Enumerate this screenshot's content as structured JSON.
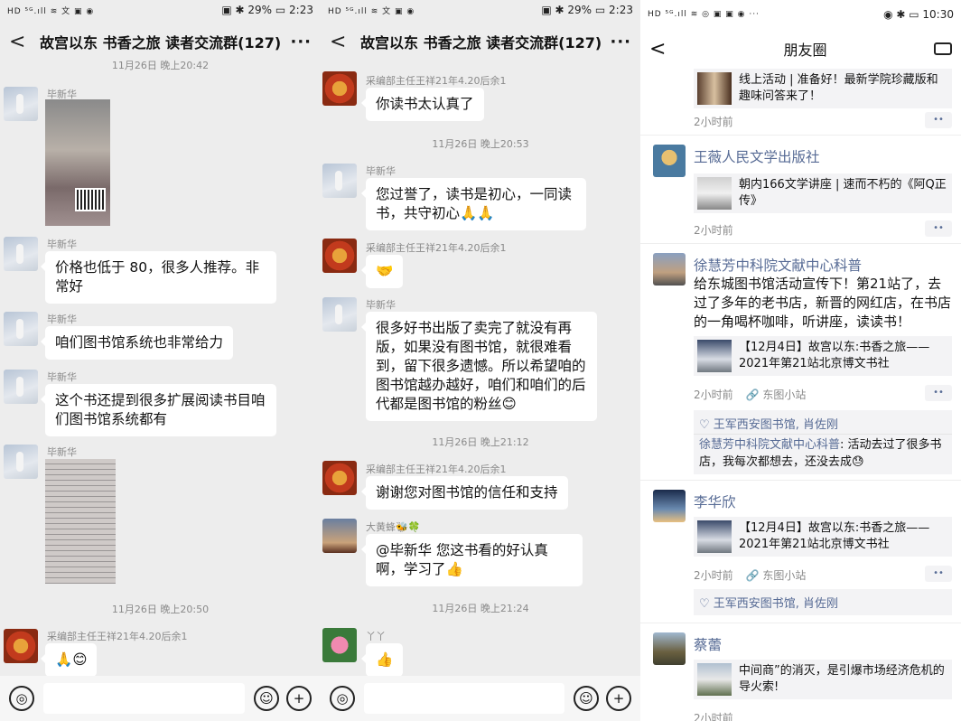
{
  "left": {
    "status": {
      "left": "HD ⁵ᴳ.ıll ≋ 文 ▣ ◉",
      "right": "▣ ✱ 29% ▭ 2:23"
    },
    "nav": {
      "back": "<",
      "title": "故宫以东 书香之旅 读者交流群(127)",
      "more": "···"
    },
    "time1": "11月26日 晚上20:42",
    "msgs": [
      {
        "name": "毕新华"
      },
      {
        "name": "毕新华",
        "text": "价格也低于 80，很多人推荐。非常好"
      },
      {
        "name": "毕新华",
        "text": "咱们图书馆系统也非常给力"
      },
      {
        "name": "毕新华",
        "text": "这个书还提到很多扩展阅读书目咱们图书馆系统都有"
      },
      {
        "name": "毕新华"
      },
      {
        "name": "采编部主任王祥21年4.20后余1",
        "text": "🙏😊"
      }
    ],
    "time2": "11月26日 晚上20:50"
  },
  "middle": {
    "status": {
      "left": "HD ⁵ᴳ.ıll ≋ 文 ▣ ◉",
      "right": "▣ ✱ 29% ▭ 2:23"
    },
    "nav": {
      "back": "<",
      "title": "故宫以东 书香之旅 读者交流群(127)",
      "more": "···"
    },
    "msgs": [
      {
        "name": "采编部主任王祥21年4.20后余1",
        "text": "你读书太认真了"
      },
      {
        "name": "毕新华",
        "text": "您过誉了，读书是初心，一同读书，共守初心🙏🙏"
      },
      {
        "name": "采编部主任王祥21年4.20后余1",
        "text": "🤝"
      },
      {
        "name": "毕新华",
        "text": "很多好书出版了卖完了就没有再版，如果没有图书馆，就很难看到，留下很多遗憾。所以希望咱的图书馆越办越好，咱们和咱们的后代都是图书馆的粉丝😊"
      },
      {
        "name": "采编部主任王祥21年4.20后余1",
        "text": "谢谢您对图书馆的信任和支持"
      },
      {
        "name": "大黄蜂🐝🍀",
        "text": "@毕新华  您这书看的好认真啊，学习了👍"
      },
      {
        "name": "丫丫",
        "text": "👍"
      }
    ],
    "times": [
      "11月26日 晚上20:53",
      "11月26日 晚上21:12",
      "11月26日 晚上21:24"
    ]
  },
  "right": {
    "status": {
      "left": "HD ⁵ᴳ.ıll ≋ ◎ ▣ ▣ ◉ ···",
      "right": "◉ ✱ ▭ 10:30"
    },
    "nav": {
      "back": "<",
      "title": "朋友圈"
    },
    "posts": [
      {
        "share": "线上活动 | 准备好！最新学院珍藏版和趣味问答来了！",
        "meta": "2小时前"
      },
      {
        "name": "王薇人民文学出版社",
        "share": "朝内166文学讲座 | 速而不朽的《阿Q正传》",
        "meta": "2小时前"
      },
      {
        "name": "徐慧芳中科院文献中心科普",
        "text": "给东城图书馆活动宣传下！第21站了，去过了多年的老书店，新晋的网红店，在书店的一角喝杯咖啡，听讲座，读读书！",
        "share": "【12月4日】故宫以东:书香之旅——2021年第21站北京博文书社",
        "meta": "2小时前",
        "source": "🔗 东图小站",
        "likes": "♡ 王军西安图书馆, 肖佐刚",
        "comment_name": "徐慧芳中科院文献中心科普",
        "comment_text": ": 活动去过了很多书店，我每次都想去，还没去成😓"
      },
      {
        "name": "李华欣",
        "share": "【12月4日】故宫以东:书香之旅——2021年第21站北京博文书社",
        "meta": "2小时前",
        "source": "🔗 东图小站",
        "likes": "♡ 王军西安图书馆, 肖佐刚"
      },
      {
        "name": "蔡蕾",
        "share": "中间商”的消灭，是引爆市场经济危机的导火索!",
        "meta": "2小时前"
      }
    ],
    "dots": "••"
  },
  "input": {
    "voice": "◎",
    "emoji": "☺",
    "plus": "+"
  }
}
